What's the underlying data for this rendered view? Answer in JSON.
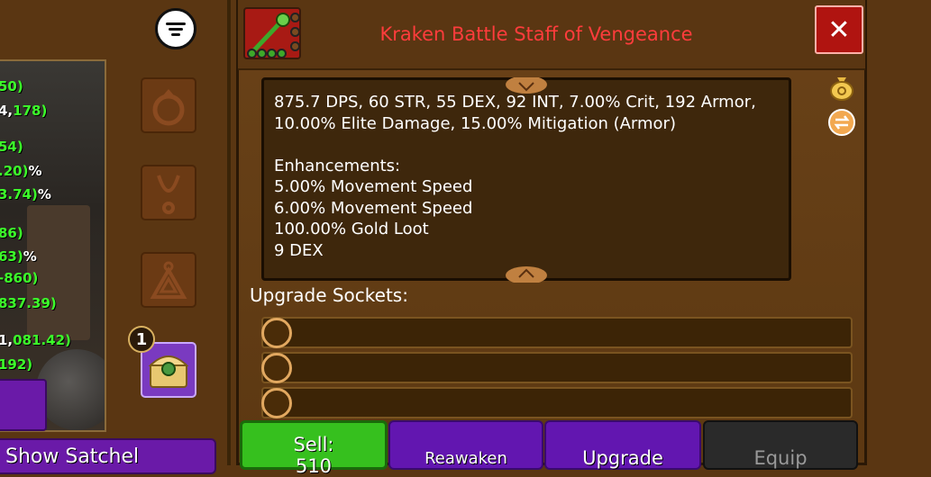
{
  "left_panel": {
    "stats": [
      {
        "green": "50)"
      },
      {
        "white": "4,",
        "green": "178)"
      },
      {
        "green": "54)"
      },
      {
        "green": ".20)",
        "white": "%"
      },
      {
        "green": "3.74)",
        "white": "%"
      },
      {
        "green": "86)"
      },
      {
        "green": "63)",
        "white": "%"
      },
      {
        "green": "-860)"
      },
      {
        "green": "837.39)"
      },
      {
        "white": "1,",
        "green": "081.42)"
      },
      {
        "green": "192)"
      }
    ],
    "show_satchel_label": "Show Satchel"
  },
  "chest": {
    "badge_count": "1"
  },
  "item": {
    "title": "Kraken Battle Staff of Vengeance",
    "title_color": "#ff3c3c",
    "description": "875.7 DPS, 60 STR, 55 DEX, 92 INT, 7.00% Crit, 192 Armor,\n10.00% Elite Damage, 15.00% Mitigation (Armor)\n\nEnhancements:\n5.00% Movement Speed\n6.00% Movement Speed\n100.00% Gold Loot\n9 DEX"
  },
  "sockets": {
    "label": "Upgrade Sockets:",
    "count": 3
  },
  "buttons": {
    "sell_label": "Sell:",
    "sell_price": "510",
    "reawaken_label": "Reawaken",
    "upgrade_label": "Upgrade",
    "equip_label": "Equip"
  },
  "icons": {
    "menu": "hamburger-menu-icon",
    "close": "close-icon",
    "gold_bag": "gold-bag-icon",
    "swap": "swap-arrows-icon",
    "ring": "ring-slot-icon",
    "amulet": "amulet-slot-icon",
    "trinket": "triangle-slot-icon",
    "chest": "treasure-chest-icon"
  },
  "colors": {
    "stat_green": "#3cff2a",
    "button_purple": "#6216b0",
    "button_green": "#36c01e",
    "close_red": "#b01410"
  }
}
